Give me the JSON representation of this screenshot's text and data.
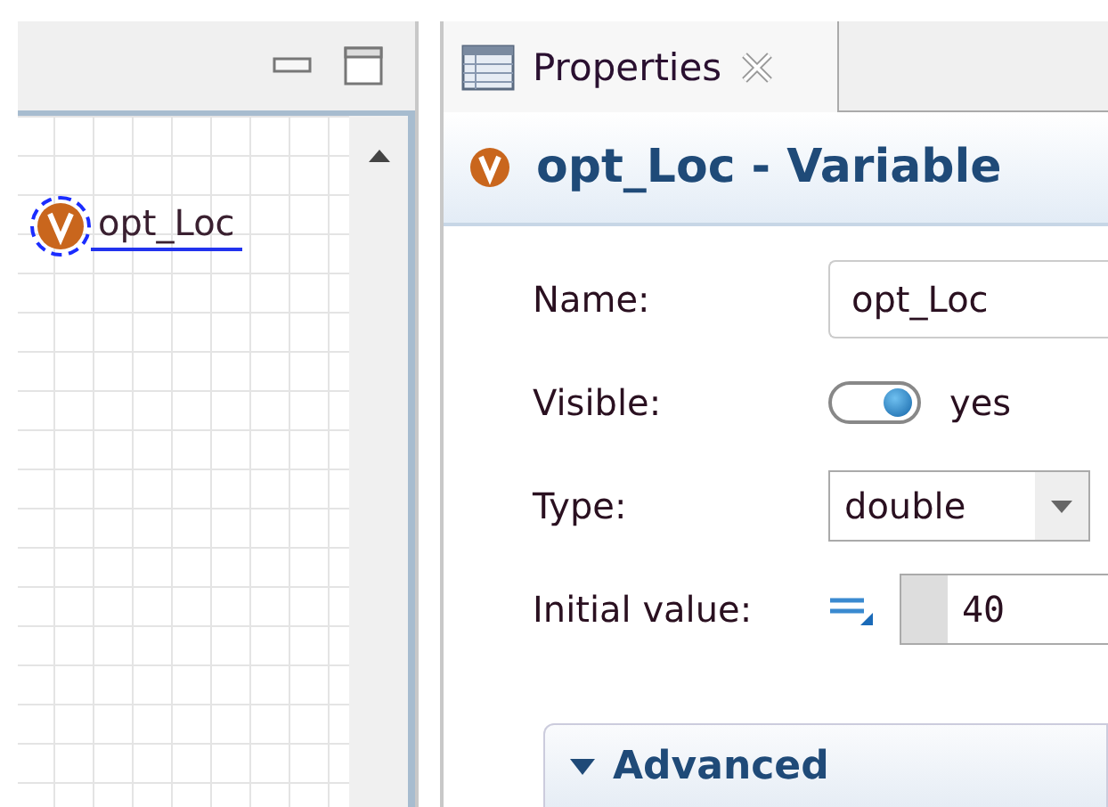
{
  "canvas": {
    "variable": {
      "label": "opt_Loc",
      "selected": true
    }
  },
  "properties_tab": {
    "label": "Properties",
    "selected": true
  },
  "title": "opt_Loc - Variable",
  "fields": [
    {
      "kind": "text",
      "label": "Name:",
      "value": "opt_Loc"
    },
    {
      "kind": "toggle",
      "label": "Visible:",
      "on": true,
      "value": "yes"
    },
    {
      "kind": "dropdown",
      "label": "Type:",
      "value": "double"
    },
    {
      "kind": "code",
      "label": "Initial value:",
      "value": "40"
    }
  ],
  "sections": [
    {
      "label": "Advanced",
      "expanded": true
    }
  ]
}
